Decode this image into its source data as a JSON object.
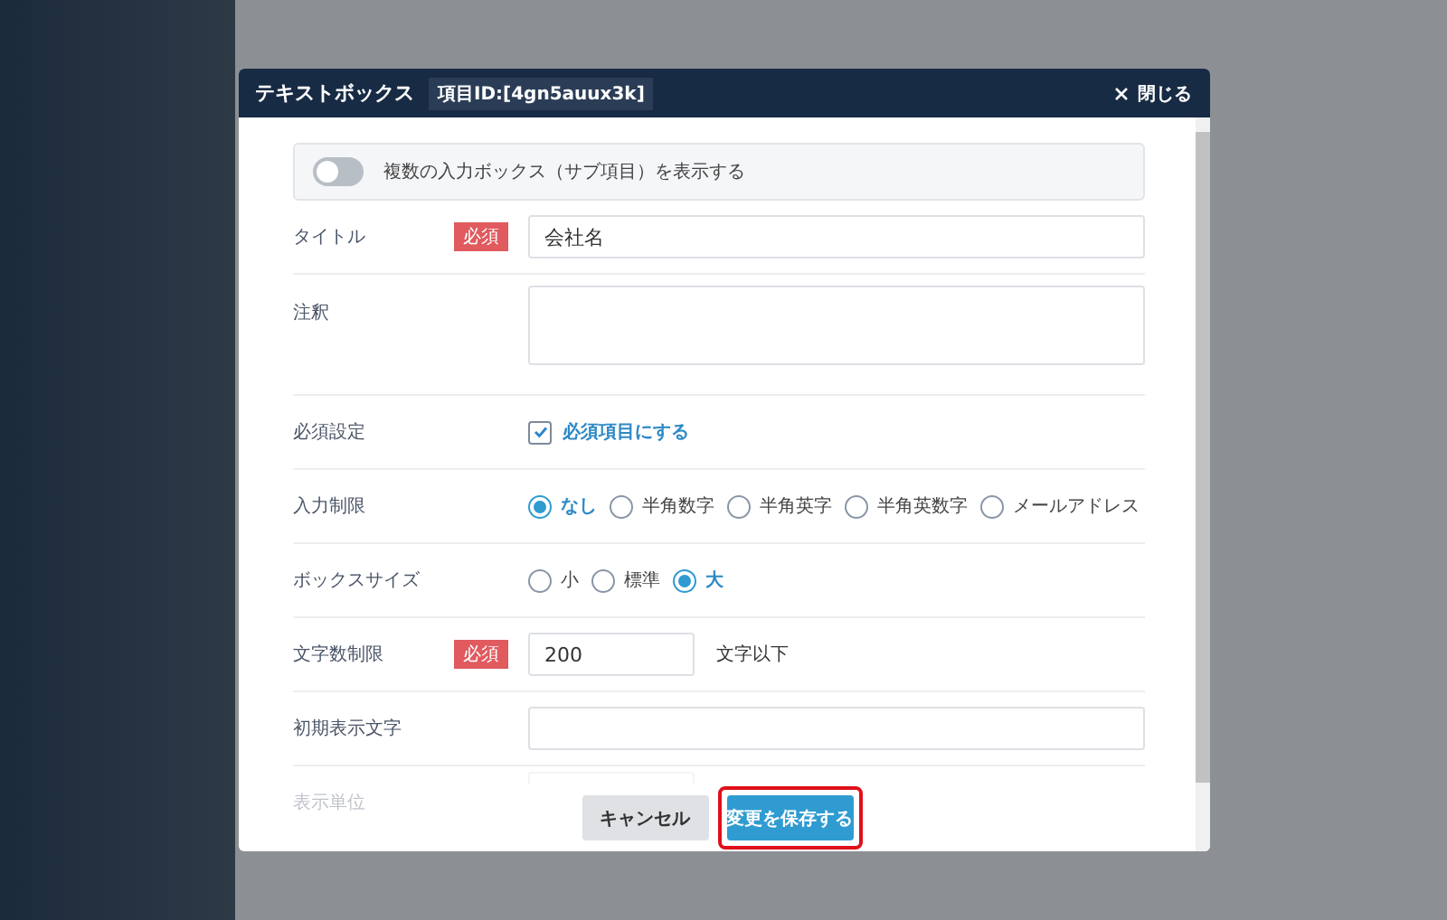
{
  "dialog": {
    "title": "テキストボックス",
    "item_id": "項目ID:[4gn5auux3k]",
    "close_label": "閉じる"
  },
  "toggle": {
    "label": "複数の入力ボックス（サブ項目）を表示する",
    "on": false
  },
  "fields": [
    {
      "kind": "text",
      "label": "タイトル",
      "required_badge": "必須",
      "value": "会社名"
    },
    {
      "kind": "textarea",
      "label": "注釈"
    },
    {
      "kind": "checkbox",
      "label": "必須設定",
      "option": "必須項目にする",
      "checked": true
    },
    {
      "kind": "radio",
      "label": "入力制限",
      "options": [
        {
          "label": "なし",
          "selected": true
        },
        {
          "label": "半角数字",
          "selected": false
        },
        {
          "label": "半角英字",
          "selected": false
        },
        {
          "label": "半角英数字",
          "selected": false
        },
        {
          "label": "メールアドレス",
          "selected": false
        }
      ]
    },
    {
      "kind": "radio",
      "label": "ボックスサイズ",
      "options": [
        {
          "label": "小",
          "selected": false
        },
        {
          "label": "標準",
          "selected": false
        },
        {
          "label": "大",
          "selected": true
        }
      ]
    },
    {
      "kind": "short",
      "label": "文字数制限",
      "required_badge": "必須",
      "value": "200",
      "suffix": "文字以下"
    },
    {
      "kind": "text",
      "label": "初期表示文字"
    },
    {
      "kind": "short",
      "label": "表示単位",
      "faded": true
    }
  ],
  "buttons": [
    {
      "label": "キャンセル",
      "kind": "secondary",
      "highlighted": false
    },
    {
      "label": "変更を保存する",
      "kind": "primary",
      "highlighted": true
    }
  ]
}
